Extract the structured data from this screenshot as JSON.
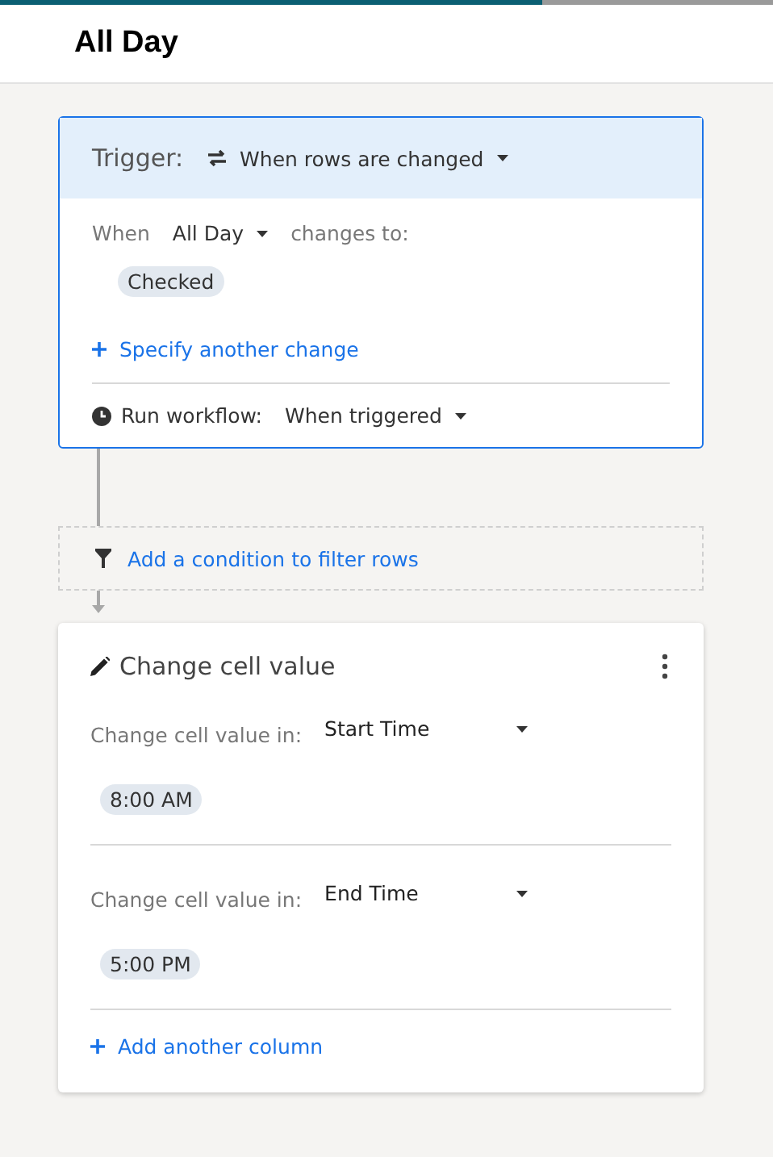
{
  "header": {
    "title": "All Day"
  },
  "trigger": {
    "label": "Trigger:",
    "type": "When rows are changed",
    "when_label": "When",
    "column": "All Day",
    "changes_label": "changes to:",
    "values": [
      "Checked"
    ],
    "add_change": "Specify another change",
    "run_label": "Run workflow:",
    "run_value": "When triggered"
  },
  "filter": {
    "label": "Add a condition to filter rows"
  },
  "action": {
    "title": "Change cell value",
    "changes": [
      {
        "label": "Change cell value in:",
        "column": "Start Time",
        "value": "8:00 AM"
      },
      {
        "label": "Change cell value in:",
        "column": "End Time",
        "value": "5:00 PM"
      }
    ],
    "add_column": "Add another column"
  }
}
